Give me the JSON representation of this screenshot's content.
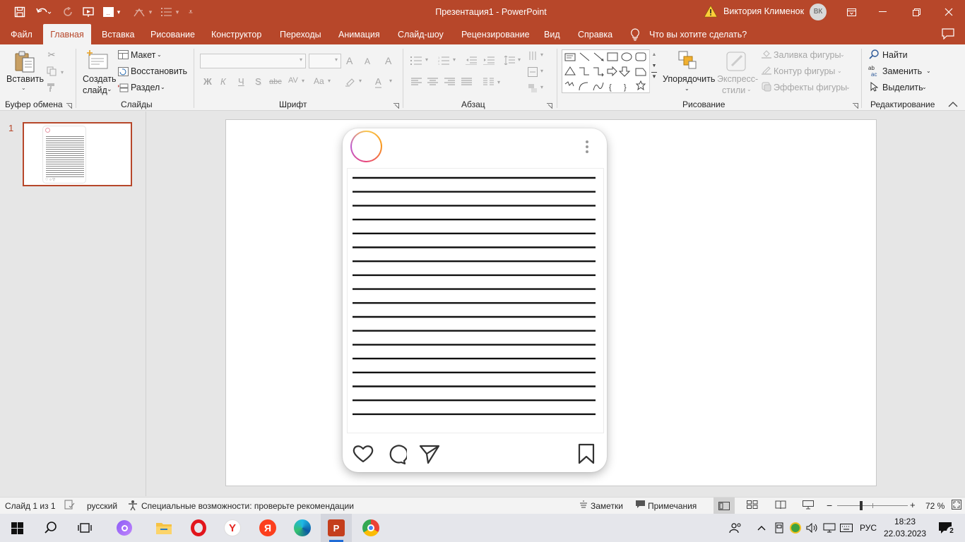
{
  "window": {
    "title": "Презентация1  -  PowerPoint",
    "user_name": "Виктория Клименок",
    "user_initials": "ВК",
    "warning_icon": "warning-icon"
  },
  "tabs": [
    "Файл",
    "Главная",
    "Вставка",
    "Рисование",
    "Конструктор",
    "Переходы",
    "Анимация",
    "Слайд-шоу",
    "Рецензирование",
    "Вид",
    "Справка"
  ],
  "tell_me": "Что вы хотите сделать?",
  "ribbon": {
    "clipboard": {
      "paste": "Вставить",
      "label": "Буфер обмена"
    },
    "slides": {
      "new_line1": "Создать",
      "new_line2": "слайд",
      "layout": "Макет",
      "reset": "Восстановить",
      "section": "Раздел",
      "label": "Слайды"
    },
    "font": {
      "label": "Шрифт",
      "bold": "Ж",
      "italic": "К",
      "underline": "Ч",
      "shadow": "S",
      "strike": "abc",
      "spacing": "AV",
      "case": "Aa",
      "grow": "A",
      "shrink": "A",
      "clear": "A",
      "color": "A"
    },
    "paragraph": {
      "label": "Абзац"
    },
    "drawing": {
      "arrange": "Упорядочить",
      "quick_line1": "Экспресс-",
      "quick_line2": "стили",
      "fill": "Заливка фигуры",
      "outline": "Контур фигуры",
      "effects": "Эффекты фигуры",
      "label": "Рисование"
    },
    "editing": {
      "find": "Найти",
      "replace": "Заменить",
      "select": "Выделить",
      "label": "Редактирование"
    }
  },
  "thumbnail": {
    "number": "1"
  },
  "statusbar": {
    "slide_info": "Слайд 1 из 1",
    "language": "русский",
    "accessibility": "Специальные возможности: проверьте рекомендации",
    "notes": "Заметки",
    "comments": "Примечания",
    "zoom": "72 %",
    "zoom_minus": "−",
    "zoom_plus": "+"
  },
  "taskbar": {
    "lang": "РУС",
    "time": "18:23",
    "date": "22.03.2023",
    "notifications": "2"
  },
  "colors": {
    "accent": "#b7472a",
    "ribbon_bg": "#f3f3f3",
    "canvas_bg": "#e6e6e6"
  }
}
